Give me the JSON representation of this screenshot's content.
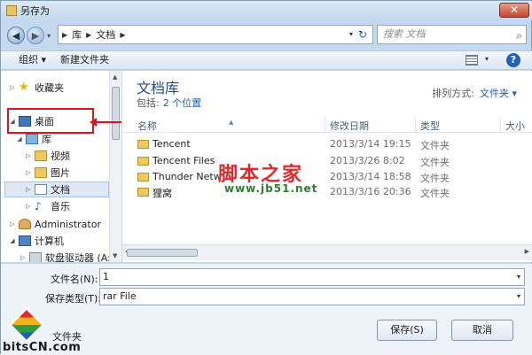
{
  "window": {
    "title": "另存为",
    "close_glyph": "✕"
  },
  "nav": {
    "back_glyph": "◀",
    "forward_glyph": "▶",
    "breadcrumb": [
      "库",
      "文档"
    ],
    "search_placeholder": "搜索 文档"
  },
  "toolbar": {
    "organize": "组织 ▾",
    "new_folder": "新建文件夹",
    "help": "?"
  },
  "sidebar": {
    "items": [
      {
        "label": "收藏夹",
        "icon": "star-icon"
      },
      {
        "label": "桌面",
        "icon": "desktop-icon"
      },
      {
        "label": "库",
        "icon": "library-icon"
      },
      {
        "label": "视频",
        "icon": "video-icon"
      },
      {
        "label": "图片",
        "icon": "pictures-icon"
      },
      {
        "label": "文档",
        "icon": "document-icon"
      },
      {
        "label": "音乐",
        "icon": "music-icon"
      },
      {
        "label": "Administrator",
        "icon": "user-icon"
      },
      {
        "label": "计算机",
        "icon": "computer-icon"
      },
      {
        "label": "软盘驱动器 (A:",
        "icon": "floppy-drive-icon"
      }
    ]
  },
  "library": {
    "title": "文档库",
    "includes_label": "包括:",
    "includes_link": "2 个位置",
    "arrange_label": "排列方式:",
    "arrange_value": "文件夹 ▾"
  },
  "columns": [
    "名称",
    "修改日期",
    "类型",
    "大小"
  ],
  "files": [
    {
      "name": "Tencent",
      "date": "2013/3/14 19:15",
      "type": "文件夹"
    },
    {
      "name": "Tencent Files",
      "date": "2013/3/26 8:02",
      "type": "文件夹"
    },
    {
      "name": "Thunder Netw",
      "date": "2013/3/14 18:58",
      "type": "文件夹"
    },
    {
      "name": "狸窝",
      "date": "2013/3/16 20:36",
      "type": "文件夹"
    }
  ],
  "form": {
    "filename_label": "文件名(N):",
    "filename_value": "1",
    "filetype_label": "保存类型(T):",
    "filetype_value": "rar File"
  },
  "buttons": {
    "save": "保存(S)",
    "cancel": "取消",
    "hide_folders": "文件夹"
  },
  "watermark": {
    "line1": "脚本之家",
    "line2": "www.jb51.net"
  },
  "logo_text": "bitsCN.com",
  "colors": {
    "highlight_red": "#e0131a",
    "link_blue": "#1f5fb5",
    "title_blue": "#1e4e8a"
  }
}
